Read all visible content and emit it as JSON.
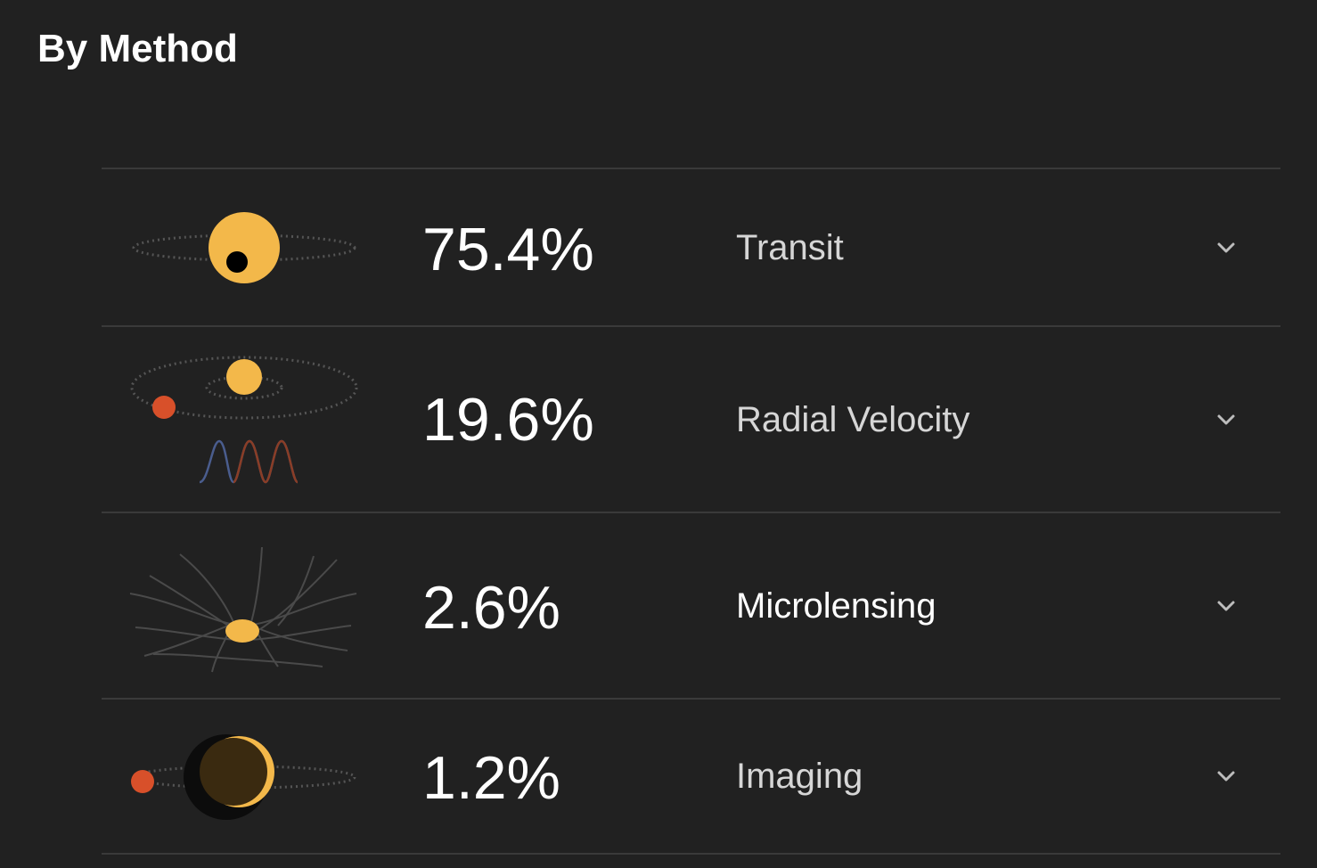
{
  "section": {
    "title": "By Method"
  },
  "methods": [
    {
      "percent": "75.4%",
      "label": "Transit",
      "label_color": "#d6d6d6",
      "icon": "transit-icon"
    },
    {
      "percent": "19.6%",
      "label": "Radial Velocity",
      "label_color": "#d6d6d6",
      "icon": "radial-velocity-icon"
    },
    {
      "percent": "2.6%",
      "label": "Microlensing",
      "label_color": "#ffffff",
      "icon": "microlensing-icon"
    },
    {
      "percent": "1.2%",
      "label": "Imaging",
      "label_color": "#d6d6d6",
      "icon": "imaging-icon"
    }
  ],
  "colors": {
    "background": "#212121",
    "star": "#f3b84a",
    "planet": "#d8502a",
    "divider": "#3a3a3a"
  }
}
